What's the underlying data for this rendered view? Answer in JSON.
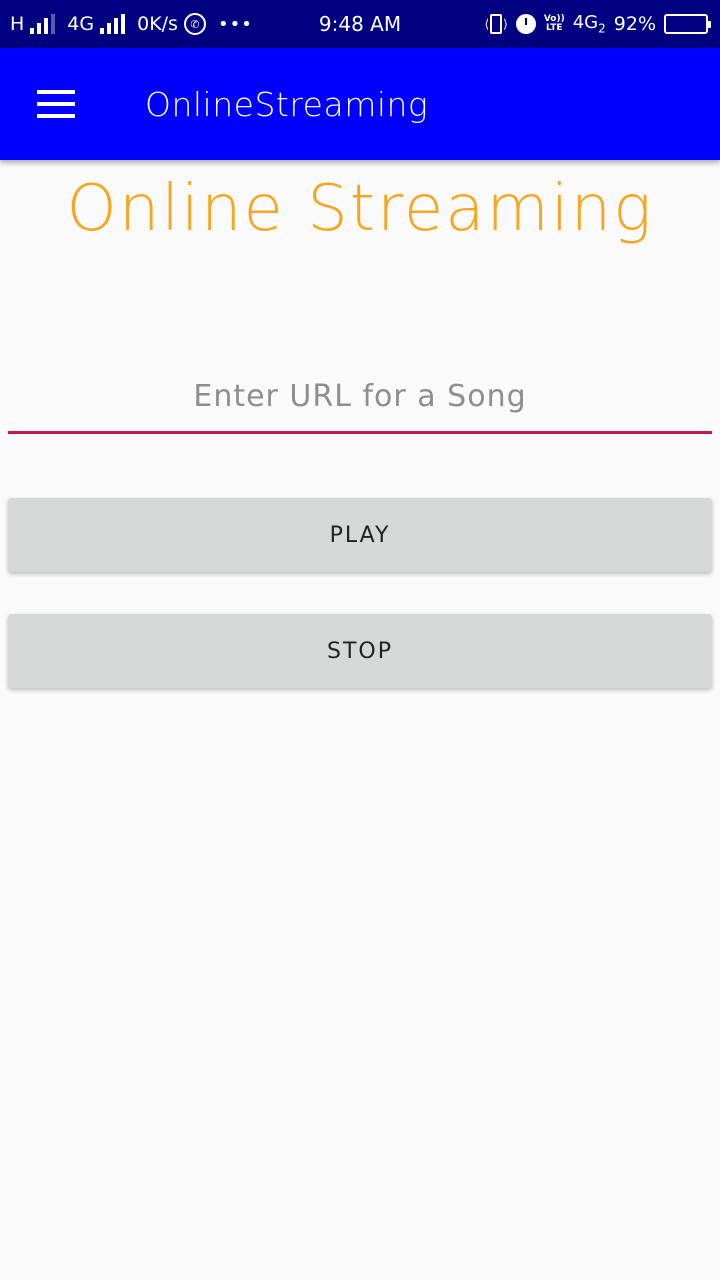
{
  "status_bar": {
    "network_h": "H",
    "network_4g": "4G",
    "speed": "0K/s",
    "whatsapp_icon": "whatsapp-icon",
    "more": "•••",
    "time": "9:48 AM",
    "volte_top": "Vo))",
    "volte_bottom": "LTE",
    "net_type": "4G",
    "sim_slot": "2",
    "battery_percent": "92%",
    "battery_level": 0.92
  },
  "app_bar": {
    "title": "OnlineStreaming",
    "menu_icon": "hamburger-menu-icon",
    "color": "#0000ff"
  },
  "main": {
    "heading": "Online Streaming",
    "heading_color": "#f5a623",
    "url_input": {
      "value": "",
      "placeholder": "Enter URL for a Song",
      "underline_color": "#c2185b"
    },
    "play_label": "PLAY",
    "stop_label": "STOP"
  }
}
